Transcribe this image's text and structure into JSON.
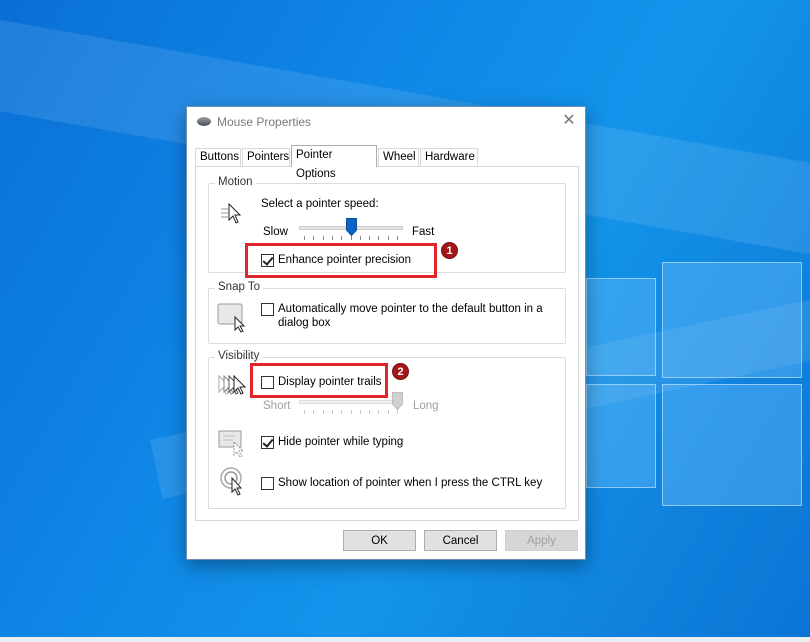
{
  "window": {
    "title": "Mouse Properties"
  },
  "tabs": [
    {
      "label": "Buttons"
    },
    {
      "label": "Pointers"
    },
    {
      "label": "Pointer Options"
    },
    {
      "label": "Wheel"
    },
    {
      "label": "Hardware"
    }
  ],
  "active_tab": "Pointer Options",
  "motion": {
    "group_label": "Motion",
    "speed_prompt": "Select a pointer speed:",
    "slow_label": "Slow",
    "fast_label": "Fast",
    "speed_value_fraction": 0.5,
    "enhance_label": "Enhance pointer precision",
    "enhance_checked": true
  },
  "snap_to": {
    "group_label": "Snap To",
    "auto_move_label": "Automatically move pointer to the default button in a dialog box",
    "auto_move_checked": false
  },
  "visibility": {
    "group_label": "Visibility",
    "trails_label": "Display pointer trails",
    "trails_checked": false,
    "short_label": "Short",
    "long_label": "Long",
    "trail_length_fraction": 1.0,
    "hide_typing_label": "Hide pointer while typing",
    "hide_typing_checked": true,
    "show_location_label": "Show location of pointer when I press the CTRL key",
    "show_location_checked": false
  },
  "annotations": {
    "badge1": "1",
    "badge2": "2",
    "highlight_color": "#e0262b"
  },
  "buttons": {
    "ok": "OK",
    "cancel": "Cancel",
    "apply": "Apply"
  }
}
